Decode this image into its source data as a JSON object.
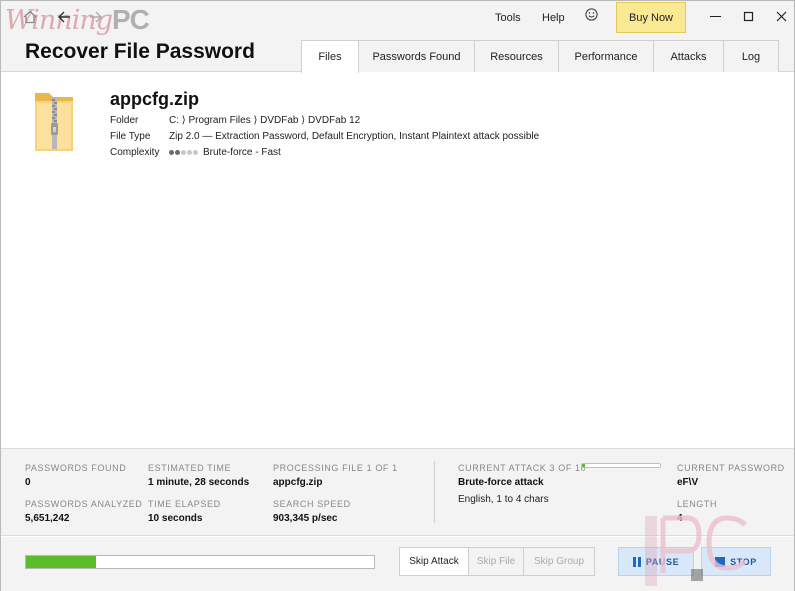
{
  "header": {
    "app_title": "Recover File Password",
    "watermark_text": "Winning",
    "watermark_suffix": "PC",
    "menu": {
      "tools": "Tools",
      "help": "Help"
    },
    "buy_now": "Buy Now",
    "icons": {
      "home": "home-icon",
      "back": "arrow-left-icon",
      "forward": "arrow-right-icon",
      "feedback": "smiley-icon"
    }
  },
  "tabs": [
    {
      "label": "Files",
      "active": true
    },
    {
      "label": "Passwords Found",
      "active": false
    },
    {
      "label": "Resources",
      "active": false
    },
    {
      "label": "Performance",
      "active": false
    },
    {
      "label": "Attacks",
      "active": false
    },
    {
      "label": "Log",
      "active": false
    }
  ],
  "file": {
    "name": "appcfg.zip",
    "folder_label": "Folder",
    "folder_value": "C: ⟩ Program Files ⟩ DVDFab ⟩ DVDFab 12",
    "type_label": "File Type",
    "type_value": "Zip 2.0 — Extraction Password, Default Encryption, Instant Plaintext attack possible",
    "complexity_label": "Complexity",
    "complexity_level": 2,
    "complexity_max": 5,
    "complexity_value": "Brute-force - Fast"
  },
  "stats": {
    "passwords_found_label": "PASSWORDS FOUND",
    "passwords_found": "0",
    "passwords_analyzed_label": "PASSWORDS ANALYZED",
    "passwords_analyzed": "5,651,242",
    "estimated_time_label": "ESTIMATED TIME",
    "estimated_time": "1 minute, 28 seconds",
    "time_elapsed_label": "TIME ELAPSED",
    "time_elapsed": "10 seconds",
    "processing_label": "PROCESSING FILE 1 OF 1",
    "processing_file": "appcfg.zip",
    "search_speed_label": "SEARCH SPEED",
    "search_speed": "903,345 p/sec",
    "current_attack_label": "CURRENT ATTACK 3 OF 10",
    "current_attack_progress": 0.04,
    "current_attack": "Brute-force attack",
    "attack_detail": "English, 1 to 4 chars",
    "current_password_label": "CURRENT PASSWORD",
    "current_password": "eF\\V",
    "length_label": "LENGTH",
    "length": "4"
  },
  "controls": {
    "overall_progress": 0.2,
    "skip_attack": "Skip Attack",
    "skip_file": "Skip File",
    "skip_group": "Skip Group",
    "pause": "PAUSE",
    "stop": "STOP"
  },
  "colors": {
    "progress_green": "#5bbd2b",
    "buy_now_bg": "#fae993",
    "control_blue": "#1e6ac2"
  }
}
